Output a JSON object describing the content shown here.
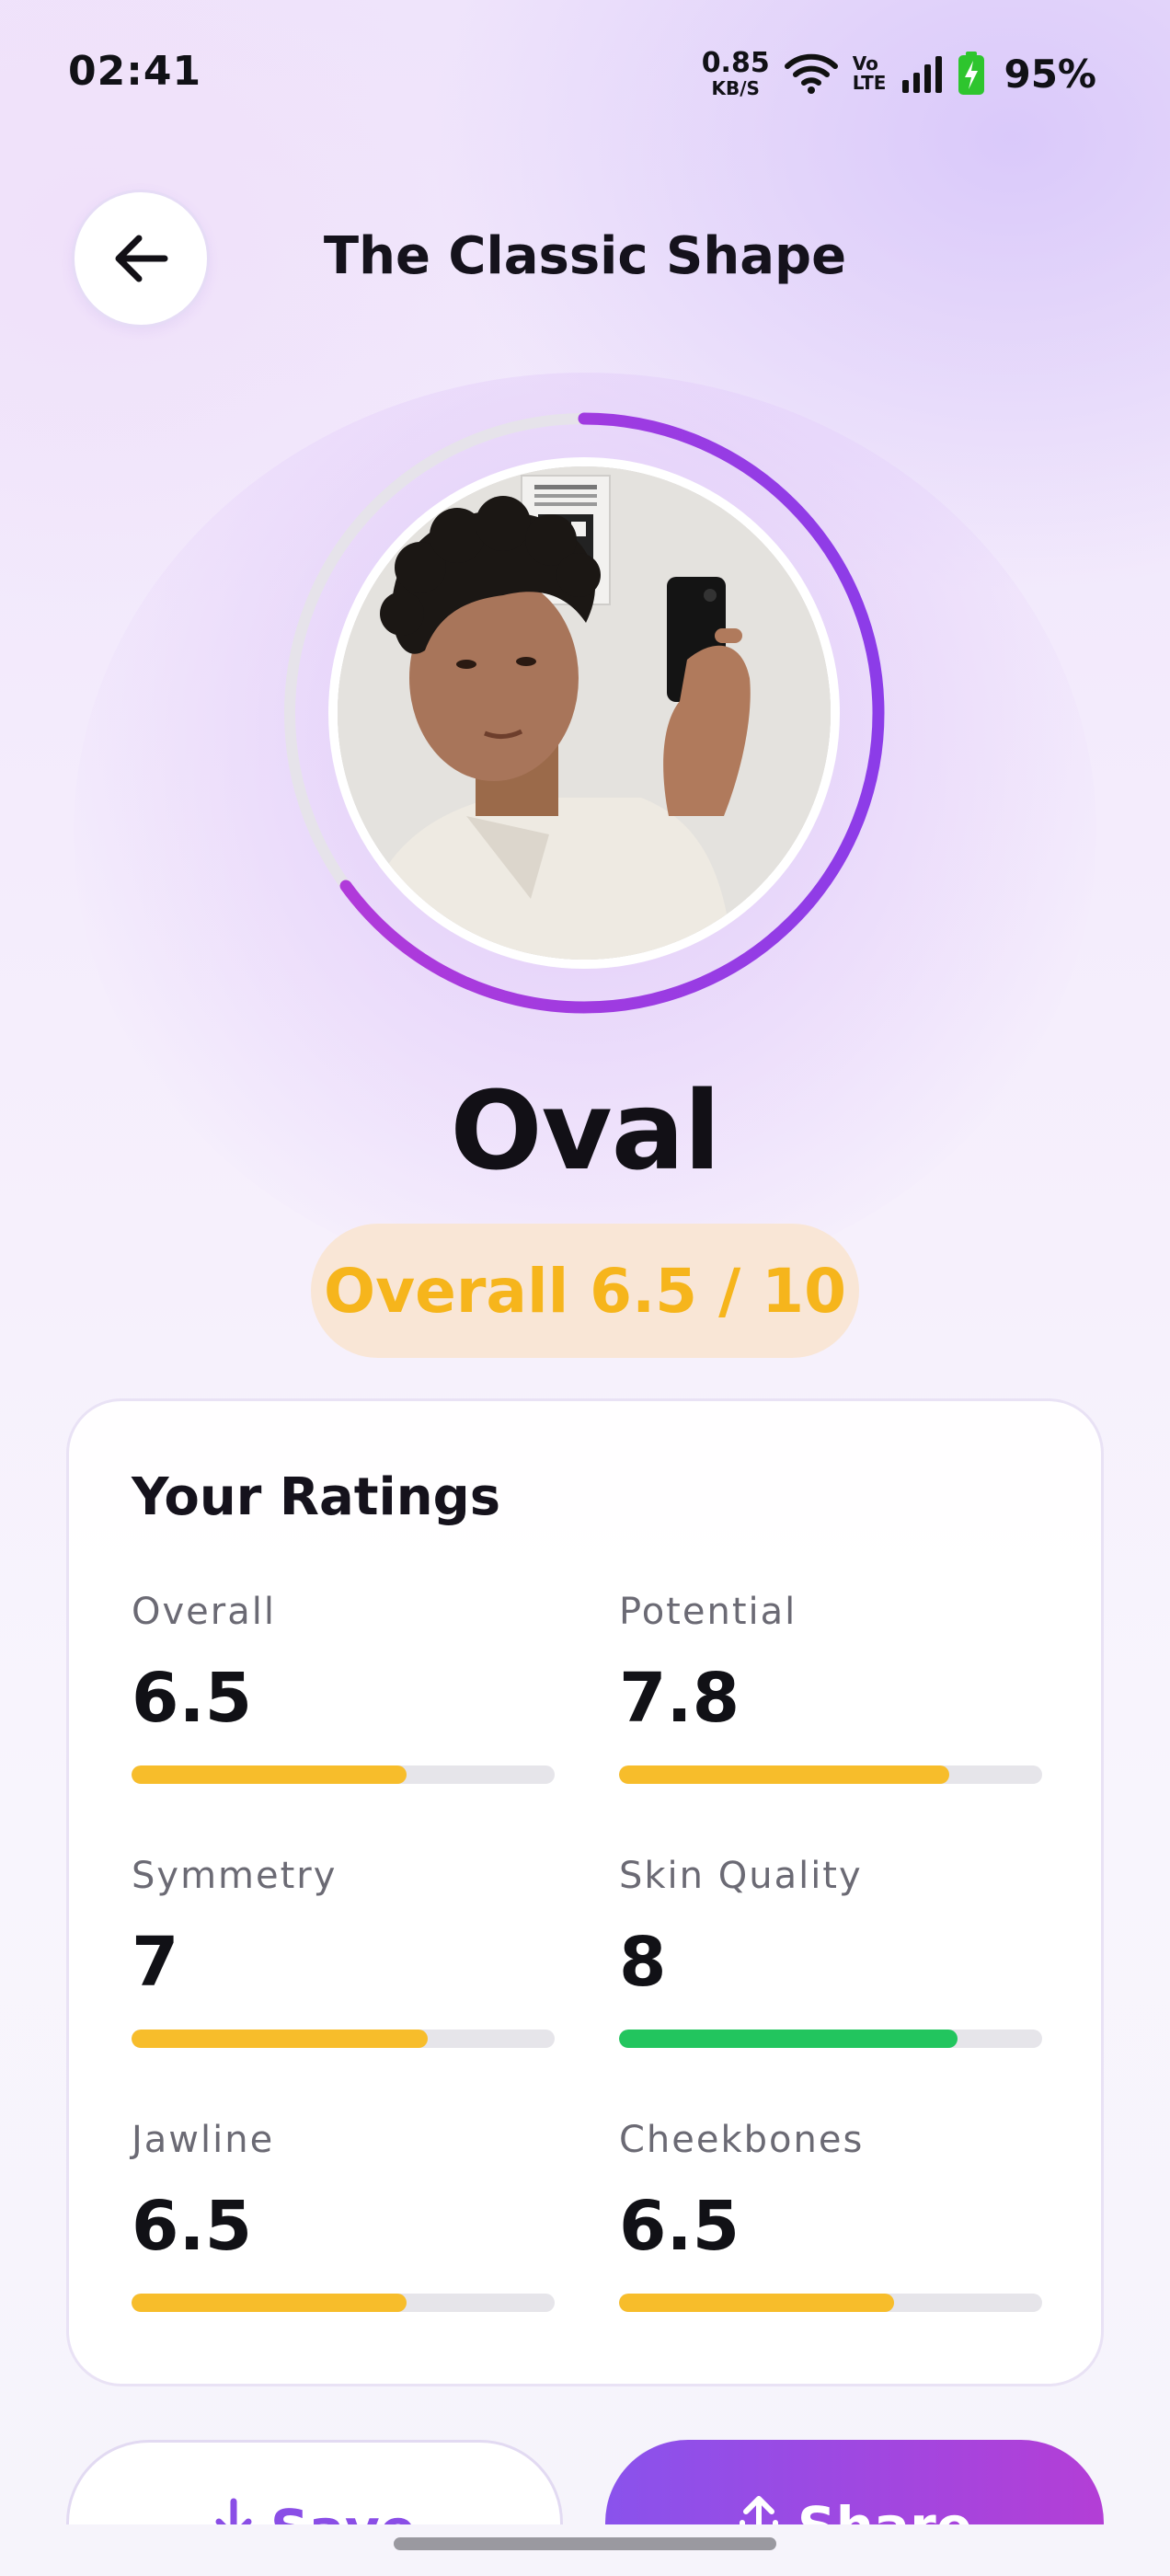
{
  "status_bar": {
    "time": "02:41",
    "net_speed": "0.85",
    "net_unit": "KB/S",
    "volte_top": "Vo",
    "volte_bottom": "LTE",
    "battery_percent": "95%"
  },
  "header": {
    "back_icon": "arrow-left-icon",
    "title": "The Classic Shape"
  },
  "result": {
    "face_shape": "Oval",
    "overall_text": "Overall 6.5 / 10",
    "overall_score": 6.5,
    "overall_max": 10,
    "ring_progress_fraction": 0.65
  },
  "ratings_card": {
    "title": "Your Ratings",
    "items": [
      {
        "label": "Overall",
        "value": "6.5",
        "fill_fraction": 0.65,
        "color": "#f7bd2b"
      },
      {
        "label": "Potential",
        "value": "7.8",
        "fill_fraction": 0.78,
        "color": "#f7bd2b"
      },
      {
        "label": "Symmetry",
        "value": "7",
        "fill_fraction": 0.7,
        "color": "#f7bd2b"
      },
      {
        "label": "Skin Quality",
        "value": "8",
        "fill_fraction": 0.8,
        "color": "#22c55e"
      },
      {
        "label": "Jawline",
        "value": "6.5",
        "fill_fraction": 0.65,
        "color": "#f7bd2b"
      },
      {
        "label": "Cheekbones",
        "value": "6.5",
        "fill_fraction": 0.65,
        "color": "#f7bd2b"
      }
    ]
  },
  "actions": {
    "save_label": "Save",
    "save_icon": "download-icon",
    "share_label": "Share",
    "share_icon": "share-icon"
  },
  "colors": {
    "accent_purple": "#a43ee0",
    "score_yellow": "#f6b51c",
    "good_green": "#22c55e"
  }
}
